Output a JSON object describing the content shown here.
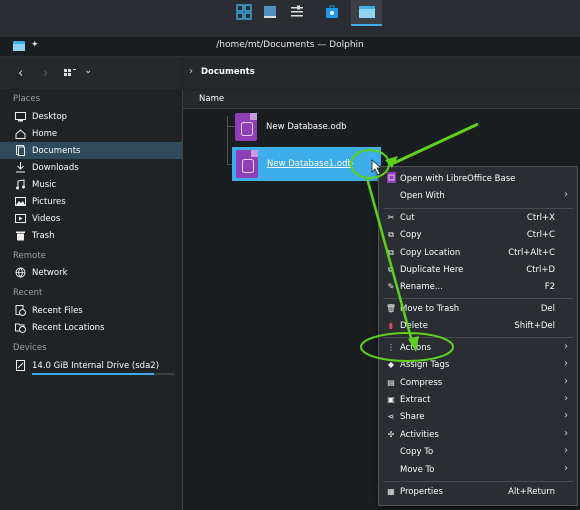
{
  "window": {
    "title": "/home/mt/Documents — Dolphin"
  },
  "breadcrumb": {
    "chevron": "›",
    "current": "Documents"
  },
  "column": {
    "name": "Name"
  },
  "sidebar": {
    "places_label": "Places",
    "places": [
      {
        "label": "Desktop",
        "icon": "desktop-icon"
      },
      {
        "label": "Home",
        "icon": "home-icon"
      },
      {
        "label": "Documents",
        "icon": "documents-icon"
      },
      {
        "label": "Downloads",
        "icon": "downloads-icon"
      },
      {
        "label": "Music",
        "icon": "music-icon"
      },
      {
        "label": "Pictures",
        "icon": "pictures-icon"
      },
      {
        "label": "Videos",
        "icon": "videos-icon"
      },
      {
        "label": "Trash",
        "icon": "trash-icon"
      }
    ],
    "remote_label": "Remote",
    "remote": [
      {
        "label": "Network",
        "icon": "network-icon"
      }
    ],
    "recent_label": "Recent",
    "recent": [
      {
        "label": "Recent Files",
        "icon": "recent-files-icon"
      },
      {
        "label": "Recent Locations",
        "icon": "recent-locations-icon"
      }
    ],
    "devices_label": "Devices",
    "devices": [
      {
        "label": "14.0 GiB Internal Drive (sda2)",
        "icon": "drive-icon",
        "usage": 0.85
      }
    ]
  },
  "files": [
    {
      "name": "New Database.odb",
      "selected": false
    },
    {
      "name": "New Database1.odb",
      "selected": true
    }
  ],
  "menu": {
    "items": [
      {
        "label": "Open with LibreOffice Base",
        "shortcut": "",
        "icon": "libreoffice-base-icon",
        "submenu": false
      },
      {
        "label": "Open With",
        "shortcut": "",
        "icon": "",
        "submenu": true
      },
      {
        "label": "Cut",
        "shortcut": "Ctrl+X",
        "icon": "scissors-icon",
        "submenu": false
      },
      {
        "label": "Copy",
        "shortcut": "Ctrl+C",
        "icon": "copy-icon",
        "submenu": false
      },
      {
        "label": "Copy Location",
        "shortcut": "Ctrl+Alt+C",
        "icon": "copy-location-icon",
        "submenu": false
      },
      {
        "label": "Duplicate Here",
        "shortcut": "Ctrl+D",
        "icon": "duplicate-icon",
        "submenu": false
      },
      {
        "label": "Rename...",
        "shortcut": "F2",
        "icon": "rename-icon",
        "submenu": false
      },
      {
        "label": "Move to Trash",
        "shortcut": "Del",
        "icon": "trash-icon",
        "submenu": false
      },
      {
        "label": "Delete",
        "shortcut": "Shift+Del",
        "icon": "delete-icon",
        "submenu": false
      },
      {
        "label": "Actions",
        "shortcut": "",
        "icon": "actions-icon",
        "submenu": true
      },
      {
        "label": "Assign Tags",
        "shortcut": "",
        "icon": "tag-icon",
        "submenu": true
      },
      {
        "label": "Compress",
        "shortcut": "",
        "icon": "compress-icon",
        "submenu": true
      },
      {
        "label": "Extract",
        "shortcut": "",
        "icon": "extract-icon",
        "submenu": true
      },
      {
        "label": "Share",
        "shortcut": "",
        "icon": "share-icon",
        "submenu": true
      },
      {
        "label": "Activities",
        "shortcut": "",
        "icon": "activities-icon",
        "submenu": true
      },
      {
        "label": "Copy To",
        "shortcut": "",
        "icon": "",
        "submenu": true
      },
      {
        "label": "Move To",
        "shortcut": "",
        "icon": "",
        "submenu": true
      },
      {
        "label": "Properties",
        "shortcut": "Alt+Return",
        "icon": "properties-icon",
        "submenu": false
      }
    ]
  },
  "colors": {
    "accent": "#3daee9",
    "annotation": "#5fd11a",
    "background": "#202326"
  }
}
